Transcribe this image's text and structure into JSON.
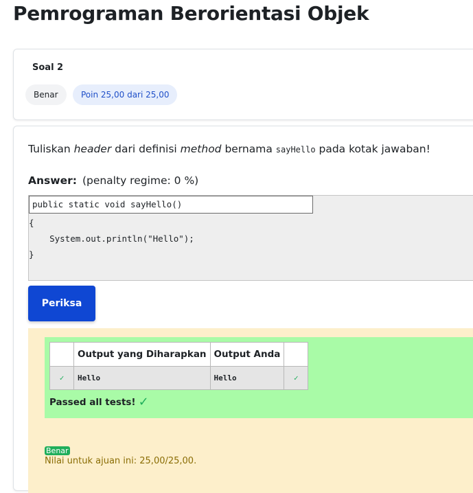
{
  "page": {
    "title": "Pemrograman Berorientasi Objek"
  },
  "info": {
    "question_no": "Soal 2",
    "state": "Benar",
    "grade": "Poin 25,00 dari 25,00"
  },
  "question": {
    "text_1": "Tuliskan ",
    "text_em1": "header",
    "text_2": " dari definisi ",
    "text_em2": "method",
    "text_3": " bernama ",
    "text_code": "sayHello",
    "text_4": " pada kotak jawaban!",
    "answer_label": "Answer:",
    "penalty": "(penalty regime: 0 %)"
  },
  "code": {
    "input_value": "public static void sayHello()",
    "line1": "{",
    "line2": "    System.out.println(\"Hello\");",
    "line3": "}"
  },
  "actions": {
    "check_label": "Periksa"
  },
  "results": {
    "headers": [
      "",
      "Output yang Diharapkan",
      "Output Anda",
      ""
    ],
    "rows": [
      {
        "expected": "Hello",
        "got": "Hello"
      }
    ],
    "passed_text": "Passed all tests!",
    "correct_badge": "Benar",
    "grade_text": "Nilai untuk ajuan ini: 25,00/25,00."
  },
  "colors": {
    "primary": "#0f47d3",
    "success": "#1fae5b",
    "pass_bg": "#a9fba7",
    "feedback_bg": "#fdefcb"
  }
}
